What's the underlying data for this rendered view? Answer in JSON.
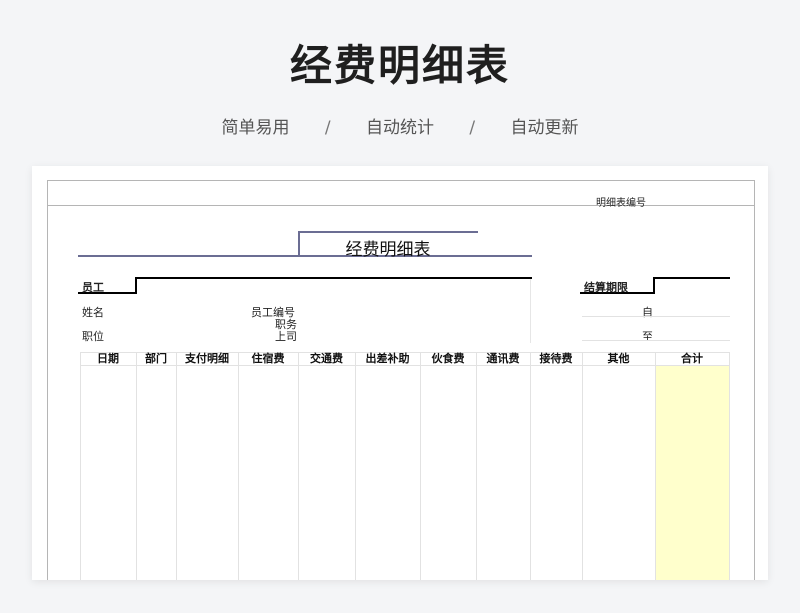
{
  "page": {
    "title": "经费明细表",
    "tagline": [
      "简单易用",
      "自动统计",
      "自动更新"
    ],
    "separator": "/"
  },
  "sheet": {
    "code_label": "明细表编号",
    "doc_title": "经费明细表",
    "employee_section": "员工",
    "period_section": "结算期限",
    "fields": {
      "name": "姓名",
      "position": "职位",
      "employee_no": "员工编号",
      "duty": "职务",
      "supervisor": "上司",
      "from": "自",
      "to": "至"
    },
    "columns": [
      "日期",
      "部门",
      "支付明细",
      "住宿费",
      "交通费",
      "出差补助",
      "伙食费",
      "通讯费",
      "接待费",
      "其他",
      "合计"
    ],
    "colors": {
      "accent": "#6b6d93",
      "total_fill": "#ffffcc"
    }
  }
}
